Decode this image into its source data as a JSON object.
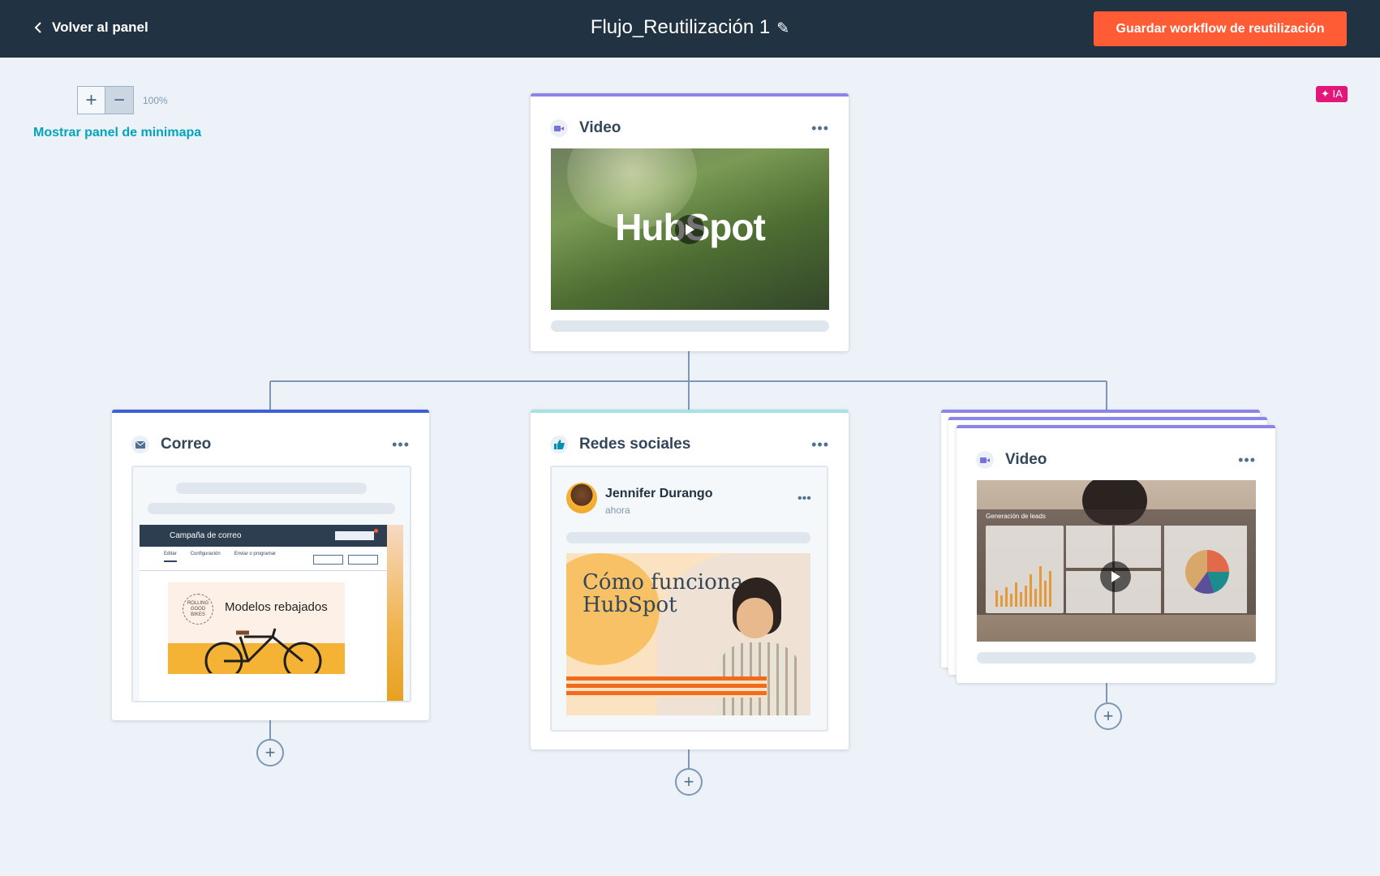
{
  "header": {
    "back_label": "Volver al panel",
    "title": "Flujo_Reutilización 1",
    "save_label": "Guardar workflow de reutilización"
  },
  "canvas": {
    "zoom_level": "100%",
    "minimap_label": "Mostrar panel de minimapa",
    "ai_badge": "✦ IA"
  },
  "colors": {
    "header_bg": "#213343",
    "accent_orange": "#ff5c35",
    "teal_link": "#00a4bd",
    "video_stripe": "#8c84e8",
    "email_stripe": "#3f5fd6",
    "social_stripe": "#a6e3e0"
  },
  "nodes": {
    "root": {
      "label": "Video",
      "icon": "video-camera-icon",
      "thumbnail_logo": "HubSpot",
      "more_label": "•••"
    },
    "email": {
      "label": "Correo",
      "icon": "envelope-icon",
      "more_label": "•••",
      "preview": {
        "header": "Campaña de correo",
        "tabs": [
          "Editar",
          "Configuración",
          "Enviar o programar"
        ],
        "brand": "ROLLING GOOD BIKES",
        "promo_text": "Modelos rebajados"
      }
    },
    "social": {
      "label": "Redes sociales",
      "icon": "thumbs-up-icon",
      "more_label": "•••",
      "post": {
        "author": "Jennifer Durango",
        "time": "ahora",
        "image_title_line1": "Cómo funciona",
        "image_title_line2": "HubSpot"
      }
    },
    "video2": {
      "label": "Video",
      "icon": "video-camera-icon",
      "more_label": "•••",
      "thumbnail_caption": "Generación de leads"
    }
  }
}
